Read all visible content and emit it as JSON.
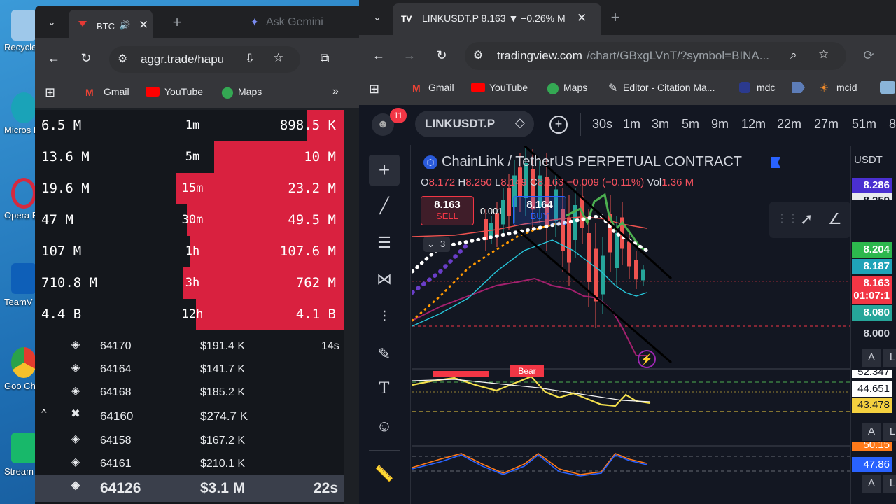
{
  "desktop": {
    "icons": [
      {
        "label": "Recycle",
        "color": "#9ec8ea"
      },
      {
        "label": "Micros Edge",
        "color": "#1aa3b8"
      },
      {
        "label": "Opera Brow",
        "color": "#d62a3f"
      },
      {
        "label": "TeamV",
        "color": "#0e5fb8"
      },
      {
        "label": "Goo Chro",
        "color": "#e6e6e6"
      },
      {
        "label": "Stream",
        "color": "#18b86a"
      }
    ]
  },
  "left_window": {
    "tab_title": "BTC",
    "new_tab": "+",
    "ask_gemini": "Ask Gemini",
    "url": "aggr.trade/hapu",
    "bookmarks": [
      "Gmail",
      "YouTube",
      "Maps"
    ],
    "stats": [
      {
        "left": "6.5 M",
        "tf": "1m",
        "right": "898.5 K",
        "fill": 0.12
      },
      {
        "left": "13.6 M",
        "tf": "5m",
        "right": "10 M",
        "fill": 0.42
      },
      {
        "left": "19.6 M",
        "tf": "15m",
        "right": "23.2 M",
        "fill": 0.545
      },
      {
        "left": "47 M",
        "tf": "30m",
        "right": "49.5 M",
        "fill": 0.51
      },
      {
        "left": "107 M",
        "tf": "1h",
        "right": "107.6 M",
        "fill": 0.5
      },
      {
        "left": "710.8 M",
        "tf": "3h",
        "right": "762 M",
        "fill": 0.52
      },
      {
        "left": "4.4 B",
        "tf": "12h",
        "right": "4.1 B",
        "fill": 0.48
      }
    ],
    "trades": [
      {
        "price": "64170",
        "amount": "$191.4 K",
        "age": "14s"
      },
      {
        "price": "64164",
        "amount": "$141.7 K",
        "age": ""
      },
      {
        "price": "64168",
        "amount": "$185.2 K",
        "age": ""
      },
      {
        "price": "64160",
        "amount": "$274.7 K",
        "age": ""
      },
      {
        "price": "64158",
        "amount": "$167.2 K",
        "age": ""
      },
      {
        "price": "64161",
        "amount": "$210.1 K",
        "age": ""
      },
      {
        "price": "64126",
        "amount": "$3.1 M",
        "age": "22s"
      }
    ]
  },
  "right_window": {
    "tab_title": "LINKUSDT.P 8.163 ▼ −0.26% M",
    "url_main": "tradingview.com",
    "url_rest": "/chart/GBxgLVnT/?symbol=BINA...",
    "bookmarks": [
      "Gmail",
      "YouTube",
      "Maps",
      "Editor - Citation Ma...",
      "mdc",
      "",
      "mcid"
    ],
    "notif_count": "11",
    "symbol": "LINKUSDT.P",
    "timeframes": [
      "30s",
      "1m",
      "3m",
      "5m",
      "9m",
      "12m",
      "22m",
      "27m",
      "51m",
      "8"
    ],
    "chart_title": "ChainLink / TetherUS PERPETUAL CONTRACT",
    "ohlc": {
      "o": "8.172",
      "h": "8.250",
      "l": "8.149",
      "c": "8.163",
      "chg": "−0.009 (−0.11%)",
      "vol": "1.36 M"
    },
    "sell": {
      "price": "8.163",
      "label": "SELL"
    },
    "spread": "0.001",
    "buy": {
      "price": "8.164",
      "label": "BUY"
    },
    "layers": "3",
    "bear_label": "Bear",
    "currency": "USDT",
    "price_labels": [
      {
        "text": "8.286",
        "bg": "#4a2fd1"
      },
      {
        "text": "8.259",
        "bg": "#e8eaed"
      },
      {
        "text": "8.204",
        "bg": "#2db84d"
      },
      {
        "text": "8.187",
        "bg": "#1fa3b8"
      },
      {
        "text": "8.163",
        "bg": "#f23645"
      },
      {
        "text": "01:07:1",
        "bg": "#f23645"
      },
      {
        "text": "8.080",
        "bg": "#26a69a"
      },
      {
        "text": "8.000",
        "bg": "#131722"
      }
    ],
    "osc_labels": [
      {
        "text": "52.347",
        "bg": "#ffffff"
      },
      {
        "text": "44.651",
        "bg": "#ffffff"
      },
      {
        "text": "43.478",
        "bg": "#f4d03f"
      },
      {
        "text": "50.15",
        "bg": "#ff7a1a"
      },
      {
        "text": "47.86",
        "bg": "#2962ff"
      }
    ],
    "scale_a": "A",
    "scale_l": "L"
  }
}
